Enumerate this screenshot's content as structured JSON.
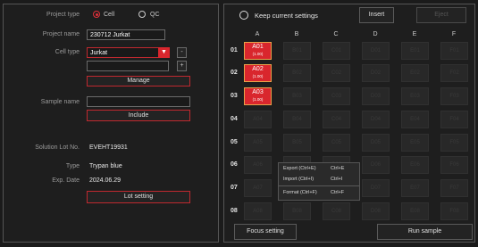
{
  "project": {
    "type_label": "Project type",
    "type_options": [
      "Cell",
      "QC"
    ],
    "name_label": "Project name",
    "name_value": "230712 Jurkat",
    "cell_type_label": "Cell type",
    "cell_type_value": "Jurkat",
    "minus_label": "-",
    "plus_label": "+",
    "manage_label": "Manage",
    "sample_name_label": "Sample name",
    "include_label": "Include"
  },
  "solution": {
    "lot_label": "Solution Lot No.",
    "lot_value": "EVEHT19931",
    "type_label": "Type",
    "type_value": "Trypan blue",
    "exp_label": "Exp. Date",
    "exp_value": "2024.06.29",
    "lot_setting_label": "Lot setting"
  },
  "toolbar": {
    "keep_label": "Keep current settings",
    "insert_label": "Insert",
    "eject_label": "Eject"
  },
  "plate": {
    "columns": [
      "A",
      "B",
      "C",
      "D",
      "E",
      "F"
    ],
    "rows": [
      "01",
      "02",
      "03",
      "04",
      "05",
      "06",
      "07",
      "08"
    ],
    "selected": [
      {
        "id": "A01",
        "value": "(1.00)"
      },
      {
        "id": "A02",
        "value": "(1.00)"
      },
      {
        "id": "A03",
        "value": "(1.00)"
      }
    ]
  },
  "context_menu": {
    "items": [
      {
        "label": "Export (Ctrl+E)",
        "shortcut": "Ctrl+E"
      },
      {
        "label": "Import (Ctrl+I)",
        "shortcut": "Ctrl+I"
      },
      {
        "label": "Format (Ctrl+F)",
        "shortcut": "Ctrl+F"
      }
    ]
  },
  "bottom": {
    "focus_label": "Focus setting",
    "run_label": "Run sample"
  },
  "colors": {
    "accent": "#d9262d",
    "selected_border": "#e8a24a",
    "background": "#1b1b1b"
  }
}
